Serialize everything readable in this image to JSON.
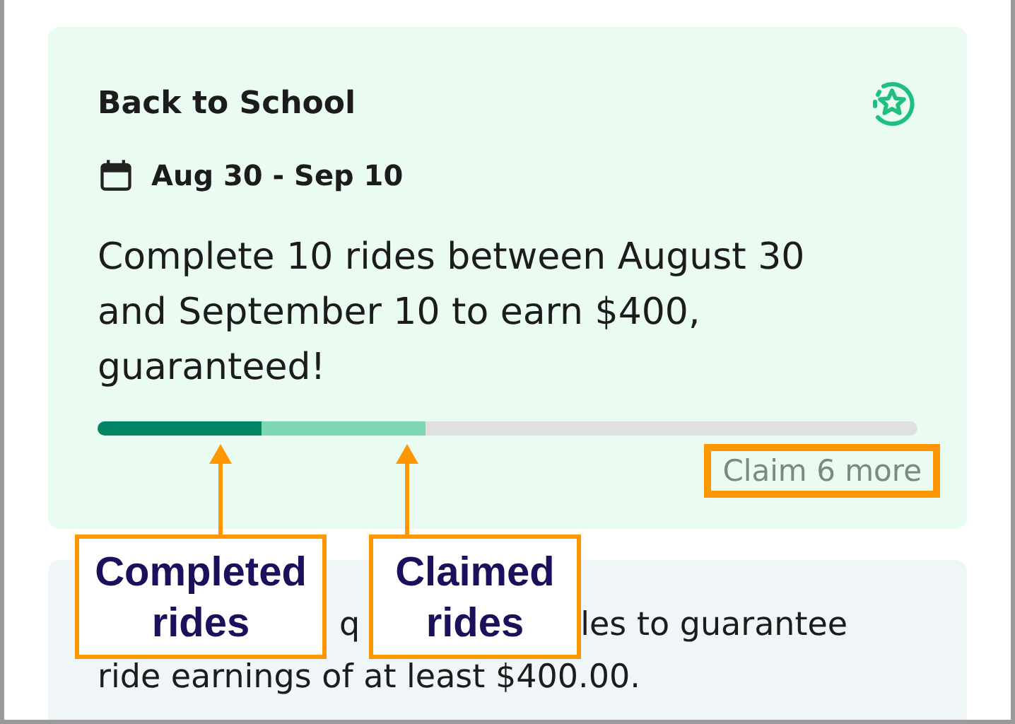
{
  "promo": {
    "title": "Back to School",
    "dates": "Aug 30 - Sep 10",
    "description": "Complete 10 rides between August 30 and September 10 to earn $400, guaranteed!",
    "progress": [
      {
        "kind": "completed",
        "level": 0.2
      },
      {
        "kind": "claimed",
        "level": 0.2
      }
    ],
    "claim_label": "Claim 6 more"
  },
  "info": {
    "line_1_fragments": [
      "q",
      "les to guarantee"
    ],
    "line_2": "ride earnings of at least $400.00."
  },
  "annotations": [
    {
      "lines": [
        "Completed",
        "rides"
      ]
    },
    {
      "lines": [
        "Claimed",
        "rides"
      ]
    }
  ]
}
